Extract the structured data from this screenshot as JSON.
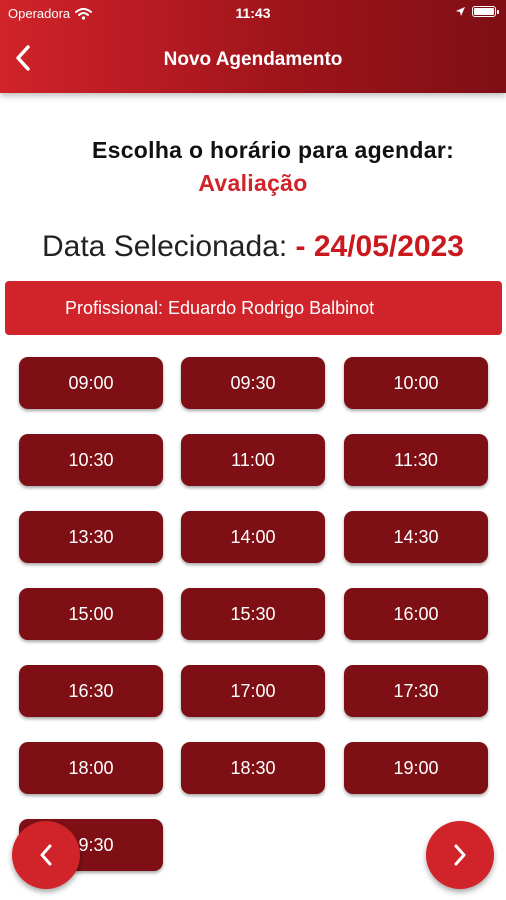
{
  "status_bar": {
    "carrier": "Operadora",
    "time": "11:43",
    "icons": [
      "wifi-icon",
      "location-arrow-icon",
      "battery-icon"
    ]
  },
  "header": {
    "title": "Novo Agendamento",
    "back_icon": "chevron-left-icon"
  },
  "content": {
    "subtitle": "Escolha o horário para agendar:",
    "service": "Avaliação",
    "date_label": "Data Selecionada:",
    "date_value": "- 24/05/2023",
    "professional": "Profissional: Eduardo Rodrigo Balbinot"
  },
  "time_slots": [
    "09:00",
    "09:30",
    "10:00",
    "10:30",
    "11:00",
    "11:30",
    "13:30",
    "14:00",
    "14:30",
    "15:00",
    "15:30",
    "16:00",
    "16:30",
    "17:00",
    "17:30",
    "18:00",
    "18:30",
    "19:00",
    "19:30"
  ],
  "nav": {
    "prev_icon": "chevron-left-icon",
    "next_icon": "chevron-right-icon"
  },
  "colors": {
    "primary": "#d1232a",
    "dark": "#7e1015",
    "date_accent": "#c8191f"
  }
}
